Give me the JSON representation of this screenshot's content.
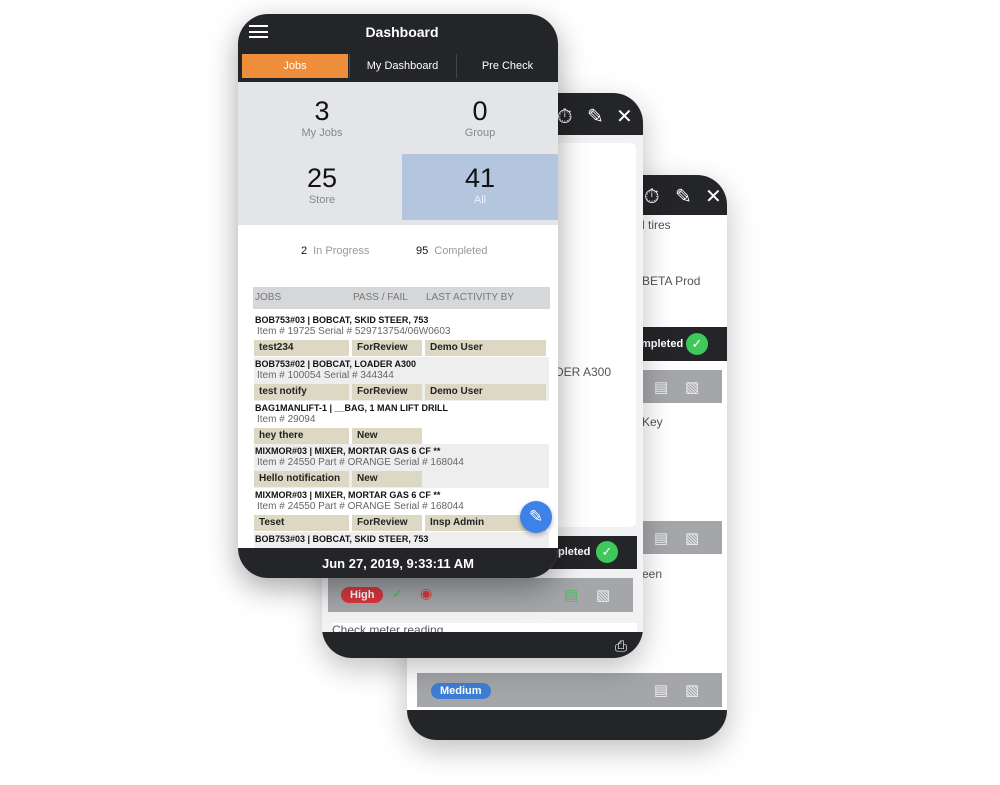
{
  "back_phone": {
    "icons": [
      "timer-icon",
      "pencil-icon",
      "close-icon"
    ],
    "text1": "l tires",
    "text2": "BETA Prod",
    "status": "mpleted",
    "text3": "Key",
    "text4": "een",
    "priority": "Medium",
    "colors": {
      "priority": "#3d7fd6"
    }
  },
  "middle_phone": {
    "icons": [
      "timer-icon",
      "pencil-icon",
      "close-icon"
    ],
    "text1": "DER A300",
    "status": "pleted",
    "priority": "High",
    "task": "Check meter reading",
    "colors": {
      "priority": "#d9363e"
    }
  },
  "front": {
    "title": "Dashboard",
    "tabs": [
      {
        "label": "Jobs",
        "active": true
      },
      {
        "label": "My Dashboard"
      },
      {
        "label": "Pre Check"
      }
    ],
    "stats": [
      {
        "value": "3",
        "label": "My Jobs"
      },
      {
        "value": "0",
        "label": "Group"
      },
      {
        "value": "25",
        "label": "Store"
      },
      {
        "value": "41",
        "label": "All",
        "selected": true
      }
    ],
    "summary": {
      "in_progress_count": "2",
      "in_progress_label": "In Progress",
      "completed_count": "95",
      "completed_label": "Completed"
    },
    "table_headers": [
      "JOBS",
      "PASS / FAIL",
      "LAST ACTIVITY BY"
    ],
    "rows": [
      {
        "title": "BOB753#03  |  BOBCAT, SKID STEER, 753",
        "sub": "Item #  19725   Serial # 529713754/06W0603",
        "cells": [
          "test234",
          "ForReview",
          "Demo User"
        ]
      },
      {
        "title": "BOB753#02  |  BOBCAT, LOADER A300",
        "sub": "Item # 100054   Serial # 344344",
        "cells": [
          "test notify",
          "ForReview",
          "Demo User"
        ]
      },
      {
        "title": "BAG1MANLIFT-1  |  __BAG, 1 MAN LIFT DRILL",
        "sub": "Item #  29094",
        "cells": [
          "hey there",
          "New"
        ]
      },
      {
        "title": "MIXMOR#03  |  MIXER, MORTAR GAS 6 CF **",
        "sub": "Item #  24550   Part # ORANGE   Serial # 168044",
        "cells": [
          "Hello notification",
          "New"
        ]
      },
      {
        "title": "MIXMOR#03  |  MIXER, MORTAR GAS 6 CF **",
        "sub": "Item #  24550   Part # ORANGE   Serial # 168044",
        "cells": [
          "Teset",
          "ForReview",
          "Insp Admin"
        ]
      },
      {
        "title": "BOB753#03  |  BOBCAT, SKID STEER, 753",
        "sub": "",
        "cells": []
      }
    ],
    "footer": "Jun 27, 2019, 9:33:11 AM",
    "colors": {
      "active_tab": "#ee8d3a",
      "selected_stat": "#b3c6de",
      "fab": "#3d82e8"
    }
  }
}
